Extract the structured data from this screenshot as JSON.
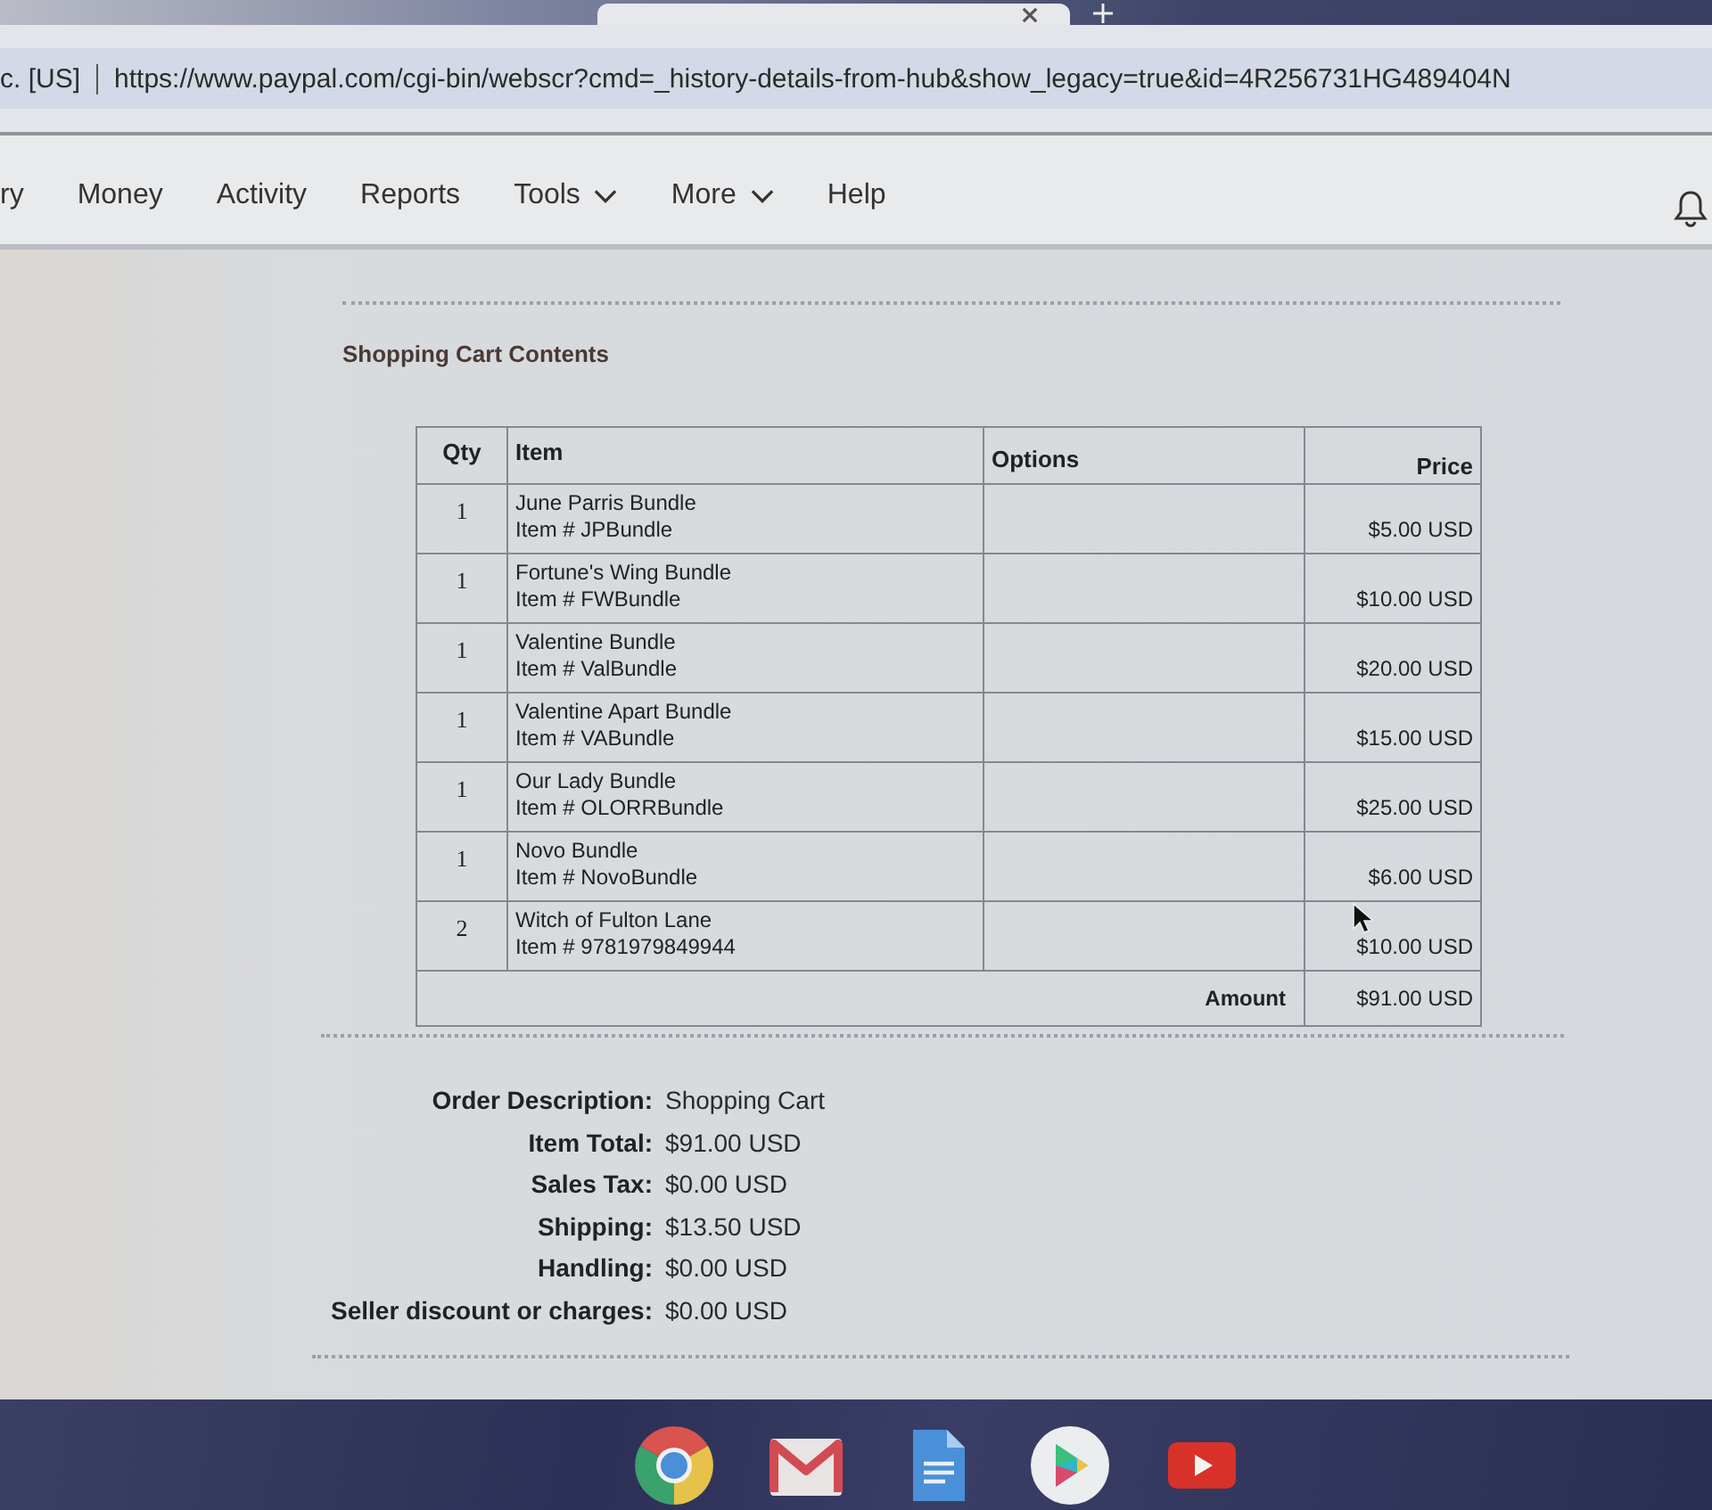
{
  "address_bar": {
    "site_label": "c. [US]",
    "url": "https://www.paypal.com/cgi-bin/webscr?cmd=_history-details-from-hub&show_legacy=true&id=4R256731HG489404N"
  },
  "nav": {
    "items": [
      {
        "label": "ry",
        "dropdown": false
      },
      {
        "label": "Money",
        "dropdown": false
      },
      {
        "label": "Activity",
        "dropdown": false
      },
      {
        "label": "Reports",
        "dropdown": false
      },
      {
        "label": "Tools",
        "dropdown": true
      },
      {
        "label": "More",
        "dropdown": true
      },
      {
        "label": "Help",
        "dropdown": false
      }
    ]
  },
  "cart": {
    "title": "Shopping Cart Contents",
    "columns": [
      "Qty",
      "Item",
      "Options",
      "Price"
    ],
    "rows": [
      {
        "qty": "1",
        "item": "June Parris Bundle",
        "item_number": "Item # JPBundle",
        "price": "$5.00 USD"
      },
      {
        "qty": "1",
        "item": "Fortune's Wing Bundle",
        "item_number": "Item # FWBundle",
        "price": "$10.00 USD"
      },
      {
        "qty": "1",
        "item": "Valentine Bundle",
        "item_number": "Item # ValBundle",
        "price": "$20.00 USD"
      },
      {
        "qty": "1",
        "item": "Valentine Apart Bundle",
        "item_number": "Item # VABundle",
        "price": "$15.00 USD"
      },
      {
        "qty": "1",
        "item": "Our Lady Bundle",
        "item_number": "Item # OLORRBundle",
        "price": "$25.00 USD"
      },
      {
        "qty": "1",
        "item": "Novo Bundle",
        "item_number": "Item # NovoBundle",
        "price": "$6.00 USD"
      },
      {
        "qty": "2",
        "item": "Witch of Fulton Lane",
        "item_number": "Item # 9781979849944",
        "price": "$10.00 USD"
      }
    ],
    "total_label": "Amount",
    "total": "$91.00 USD"
  },
  "summary": [
    {
      "label": "Order Description:",
      "value": "Shopping Cart"
    },
    {
      "label": "Item Total:",
      "value": "$91.00 USD"
    },
    {
      "label": "Sales Tax:",
      "value": "$0.00 USD"
    },
    {
      "label": "Shipping:",
      "value": "$13.50 USD"
    },
    {
      "label": "Handling:",
      "value": "$0.00 USD"
    },
    {
      "label": "Seller discount or charges:",
      "value": "$0.00 USD"
    }
  ]
}
